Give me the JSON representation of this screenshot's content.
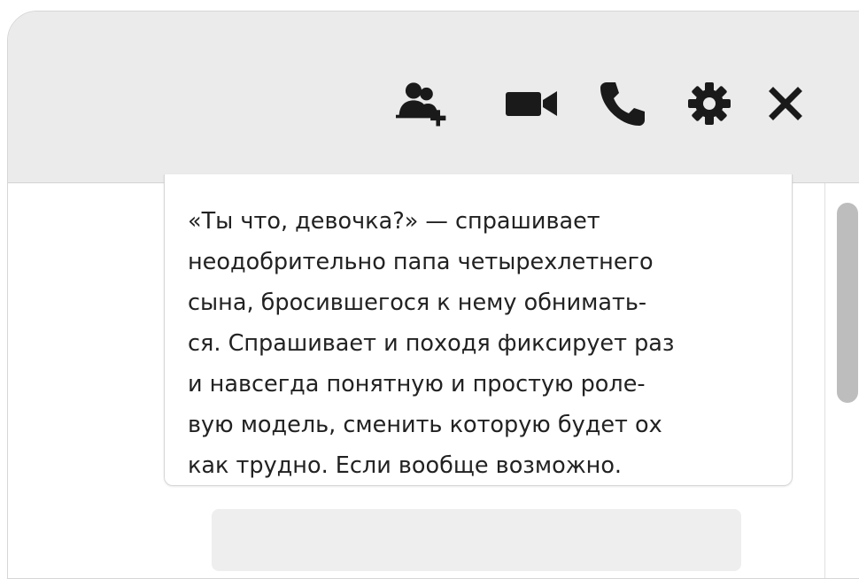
{
  "header": {
    "icons": [
      "add-contact-icon",
      "video-call-icon",
      "phone-icon",
      "gear-icon",
      "close-icon"
    ]
  },
  "message": {
    "lines": [
      "«Ты что, девочка?» — спрашивает",
      "неодобрительно папа четырехлетнего",
      "сына, бросившегося к нему обнимать-",
      "ся. Спрашивает и походя фиксирует раз",
      "и навсегда понятную и простую роле-",
      "вую модель, сменить которую будет ох",
      "как трудно. Если вообще возможно."
    ]
  },
  "colors": {
    "header_bg": "#ebebeb",
    "icon_color": "#1a1a1a",
    "scroll_thumb": "#bdbdbd",
    "placeholder_bg": "#eeeeee"
  }
}
